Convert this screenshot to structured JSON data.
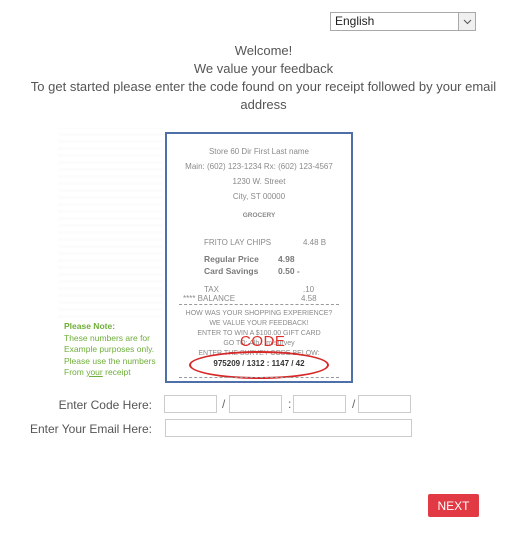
{
  "language_select": {
    "selected": "English"
  },
  "intro": {
    "line1": "Welcome!",
    "line2": "We value your feedback",
    "line3": "To get started please enter the code found on your receipt followed by your email address"
  },
  "receipt": {
    "store": "Store 60 Dir First Last name",
    "phones": "Main: (602) 123-1234 Rx: (602) 123-4567",
    "street": "1230 W. Street",
    "city": "City, ST 00000",
    "department": "GROCERY",
    "item_name": "FRITO LAY CHIPS",
    "item_price": "4.48 B",
    "regular_price_label": "Regular  Price",
    "regular_price": "4.98",
    "card_savings_label": "Card Savings",
    "card_savings": "0.50 -",
    "tax_label": "TAX",
    "tax": ".10",
    "balance_label": "**** BALANCE",
    "balance": "4.58",
    "survey_line1": "HOW WAS YOUR SHOPPING EXPERIENCE?",
    "survey_line2": "WE VALUE YOUR FEEDBACK!",
    "survey_line3": "ENTER TO WIN A $100.00 GIFT CARD",
    "survey_line4": "GO TO: Alb…m/survey",
    "survey_line5": "ENTER THE SURVEY CODE BELOW:",
    "code_annotation": "CODE",
    "code_value": "975209 / 1312 : 1147 / 42"
  },
  "note": {
    "title": "Please Note:",
    "line1": "These numbers are for",
    "line2": "Example purposes only.",
    "line3": "Please use the numbers",
    "line4_pre": "From ",
    "line4_underlined": "your",
    "line4_post": " receipt"
  },
  "form": {
    "code_label": "Enter Code Here:",
    "code_fields": [
      "",
      "",
      "",
      ""
    ],
    "separators": [
      "/",
      ":",
      "/"
    ],
    "email_label": "Enter Your Email Here:",
    "email_value": ""
  },
  "next_button": {
    "label": "NEXT"
  },
  "colors": {
    "accent": "#e23a44",
    "note_green": "#6fae3a",
    "receipt_border": "#4f6fa8",
    "code_red": "#d62828"
  }
}
